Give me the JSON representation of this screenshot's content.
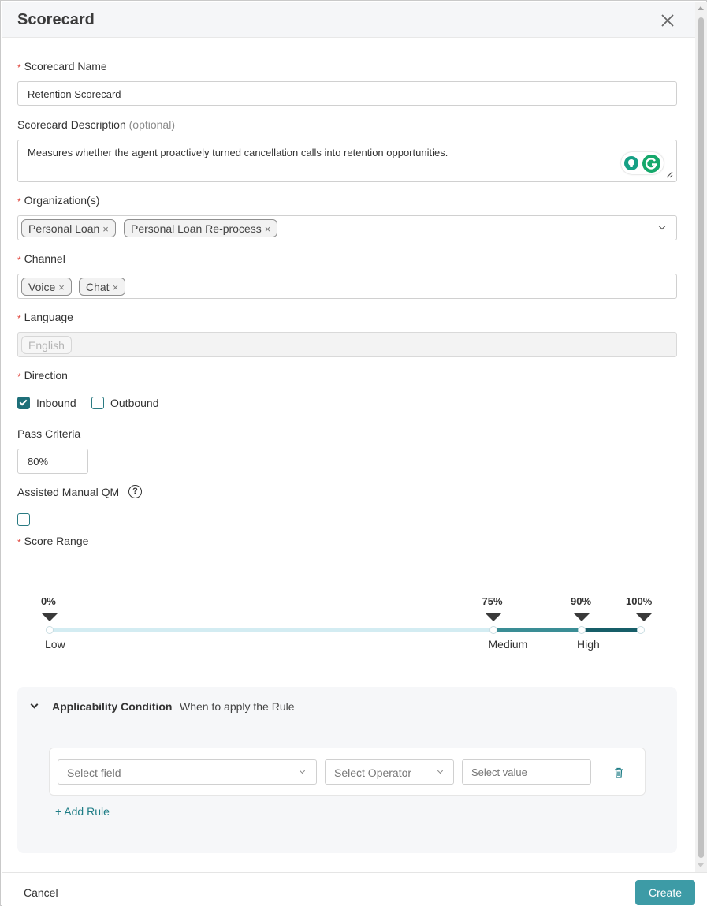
{
  "dialog": {
    "title": "Scorecard",
    "close_icon": "close-icon"
  },
  "fields": {
    "name": {
      "label": "Scorecard Name",
      "required": true,
      "value": "Retention Scorecard"
    },
    "description": {
      "label": "Scorecard Description",
      "optional_tag": "(optional)",
      "value": "Measures whether the agent proactively turned cancellation calls into retention opportunities."
    },
    "organizations": {
      "label": "Organization(s)",
      "required": true,
      "tags": [
        "Personal Loan",
        "Personal Loan Re-process"
      ],
      "tag_remove": "×"
    },
    "channel": {
      "label": "Channel",
      "required": true,
      "tags": [
        "Voice",
        "Chat"
      ],
      "tag_remove": "×"
    },
    "language": {
      "label": "Language",
      "required": true,
      "tags": [
        "English"
      ],
      "disabled": true
    },
    "direction": {
      "label": "Direction",
      "required": true,
      "options": [
        {
          "label": "Inbound",
          "checked": true
        },
        {
          "label": "Outbound",
          "checked": false
        }
      ]
    },
    "pass_criteria": {
      "label": "Pass Criteria",
      "value": "80%"
    },
    "assisted_manual_qm": {
      "label": "Assisted Manual QM",
      "help_icon": "?",
      "checked": false
    },
    "score_range": {
      "label": "Score Range",
      "required": true
    }
  },
  "chart_data": {
    "type": "range",
    "markers": [
      "0%",
      "75%",
      "90%",
      "100%"
    ],
    "bands": [
      {
        "name": "Low",
        "from": 0,
        "to": 75,
        "color": "#d3ecf2"
      },
      {
        "name": "Medium",
        "from": 75,
        "to": 90,
        "color": "#3a8d95"
      },
      {
        "name": "High",
        "from": 90,
        "to": 100,
        "color": "#175e68"
      }
    ],
    "range": [
      0,
      100
    ]
  },
  "applicability": {
    "title": "Applicability Condition",
    "subtitle": "When to apply the Rule",
    "rule": {
      "field_placeholder": "Select field",
      "operator_placeholder": "Select Operator",
      "value_placeholder": "Select value"
    },
    "add_rule_label": "+ Add Rule"
  },
  "footer": {
    "cancel_label": "Cancel",
    "create_label": "Create"
  },
  "colors": {
    "accent": "#3d9ba6",
    "required": "#e0483f",
    "checkbox": "#1e6f79"
  }
}
